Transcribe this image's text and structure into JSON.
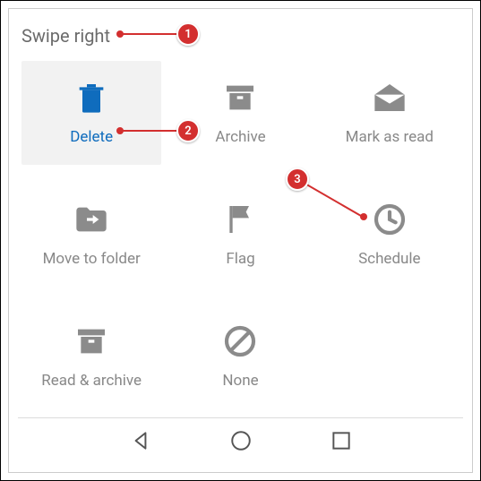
{
  "header": {
    "title": "Swipe right"
  },
  "options": [
    {
      "id": "delete",
      "label": "Delete",
      "selected": true
    },
    {
      "id": "archive",
      "label": "Archive",
      "selected": false
    },
    {
      "id": "mark-as-read",
      "label": "Mark as read",
      "selected": false
    },
    {
      "id": "move-to-folder",
      "label": "Move to folder",
      "selected": false
    },
    {
      "id": "flag",
      "label": "Flag",
      "selected": false
    },
    {
      "id": "schedule",
      "label": "Schedule",
      "selected": false
    },
    {
      "id": "read-archive",
      "label": "Read & archive",
      "selected": false
    },
    {
      "id": "none",
      "label": "None",
      "selected": false
    }
  ],
  "annotations": [
    {
      "num": "1",
      "target": "header"
    },
    {
      "num": "2",
      "target": "delete"
    },
    {
      "num": "3",
      "target": "schedule"
    }
  ],
  "colors": {
    "accent": "#0f6cbd",
    "icon_inactive": "#8b8b8b",
    "annotation": "#d32f2f"
  }
}
